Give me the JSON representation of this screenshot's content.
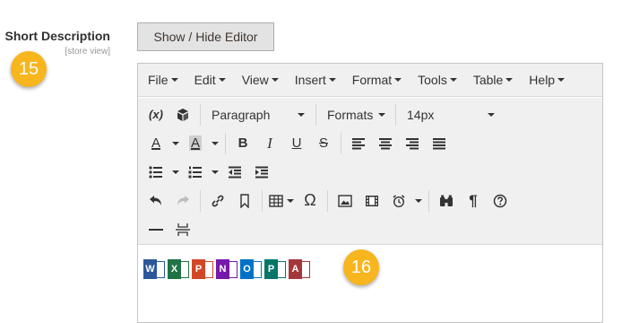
{
  "field": {
    "label": "Short Description",
    "scope": "[store view]"
  },
  "badges": {
    "first": "15",
    "second": "16"
  },
  "toggle_button": {
    "label": "Show / Hide Editor"
  },
  "menubar": [
    "File",
    "Edit",
    "View",
    "Insert",
    "Format",
    "Tools",
    "Table",
    "Help"
  ],
  "toolbar": {
    "variable_label": "(x)",
    "block_format": "Paragraph",
    "formats": "Formats",
    "font_size": "14px",
    "font_color_letter": "A",
    "bg_color_letter": "A",
    "bold": "B",
    "italic": "I",
    "underline": "U",
    "strike": "S",
    "omega": "Ω",
    "paragraph_mark": "¶"
  },
  "content": {
    "office_icons": [
      {
        "name": "word-icon",
        "letter": "W",
        "color": "#2b579a"
      },
      {
        "name": "excel-icon",
        "letter": "X",
        "color": "#217346"
      },
      {
        "name": "powerpoint-icon",
        "letter": "P",
        "color": "#d24726"
      },
      {
        "name": "onenote-icon",
        "letter": "N",
        "color": "#7719aa"
      },
      {
        "name": "outlook-icon",
        "letter": "O",
        "color": "#0072c6"
      },
      {
        "name": "publisher-icon",
        "letter": "P",
        "color": "#077568"
      },
      {
        "name": "access-icon",
        "letter": "A",
        "color": "#a4373a"
      }
    ]
  }
}
